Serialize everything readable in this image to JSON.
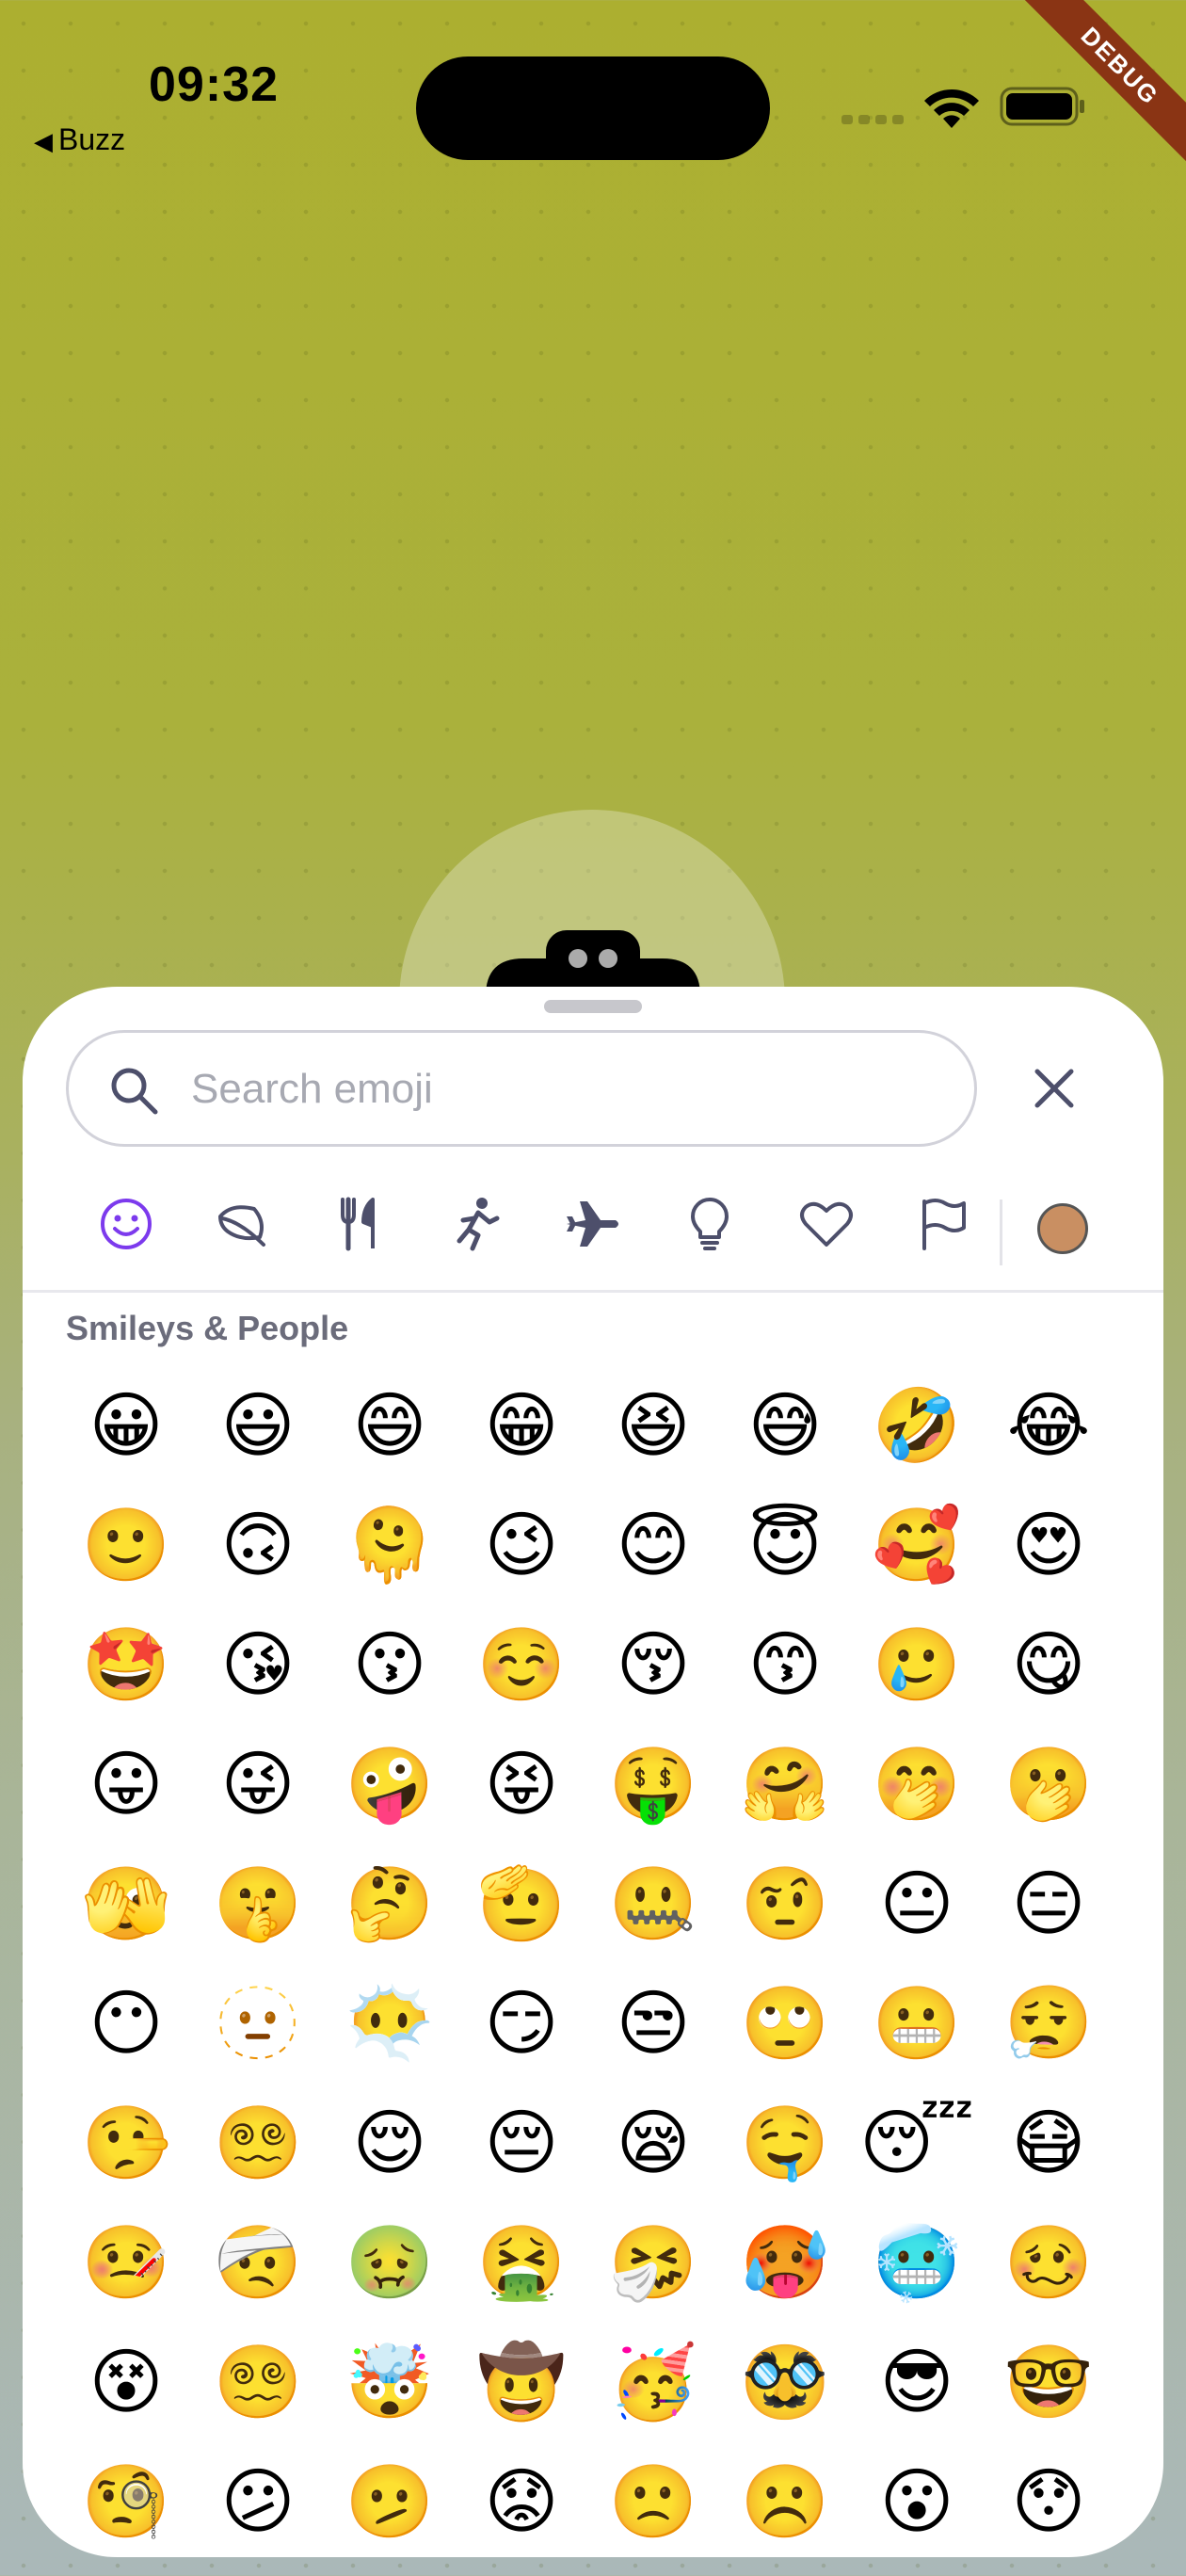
{
  "status": {
    "time": "09:32",
    "back_label": "Buzz",
    "debug_label": "DEBUG"
  },
  "search": {
    "placeholder": "Search emoji",
    "value": ""
  },
  "categories": [
    {
      "name": "smileys",
      "icon": "smiley-icon",
      "active": true
    },
    {
      "name": "animals",
      "icon": "leaf-icon"
    },
    {
      "name": "food",
      "icon": "fork-knife-icon"
    },
    {
      "name": "activities",
      "icon": "running-person-icon"
    },
    {
      "name": "travel",
      "icon": "airplane-icon"
    },
    {
      "name": "objects",
      "icon": "lightbulb-icon"
    },
    {
      "name": "symbols",
      "icon": "heart-icon"
    },
    {
      "name": "flags",
      "icon": "flag-icon"
    }
  ],
  "skin_tone": {
    "color": "#c98f62"
  },
  "colors": {
    "accent": "#7c3aed",
    "icon_gray": "#4d4f6b"
  },
  "section_title": "Smileys & People",
  "emojis": [
    "😀",
    "😃",
    "😄",
    "😁",
    "😆",
    "😅",
    "🤣",
    "😂",
    "🙂",
    "🙃",
    "🫠",
    "😉",
    "😊",
    "😇",
    "🥰",
    "😍",
    "🤩",
    "😘",
    "😗",
    "☺️",
    "😚",
    "😙",
    "🥲",
    "😋",
    "😛",
    "😜",
    "🤪",
    "😝",
    "🤑",
    "🤗",
    "🤭",
    "🫢",
    "🫣",
    "🤫",
    "🤔",
    "🫡",
    "🤐",
    "🤨",
    "😐",
    "😑",
    "😶",
    "🫥",
    "😶‍🌫️",
    "😏",
    "😒",
    "🙄",
    "😬",
    "😮‍💨",
    "🤥",
    "😵‍💫",
    "😌",
    "😔",
    "😪",
    "🤤",
    "😴",
    "😷",
    "🤒",
    "🤕",
    "🤢",
    "🤮",
    "🤧",
    "🥵",
    "🥶",
    "🥴",
    "😵",
    "😵‍💫",
    "🤯",
    "🤠",
    "🥳",
    "🥸",
    "😎",
    "🤓",
    "🧐",
    "😕",
    "🫤",
    "😟",
    "🙁",
    "☹️",
    "😮",
    "😯"
  ]
}
